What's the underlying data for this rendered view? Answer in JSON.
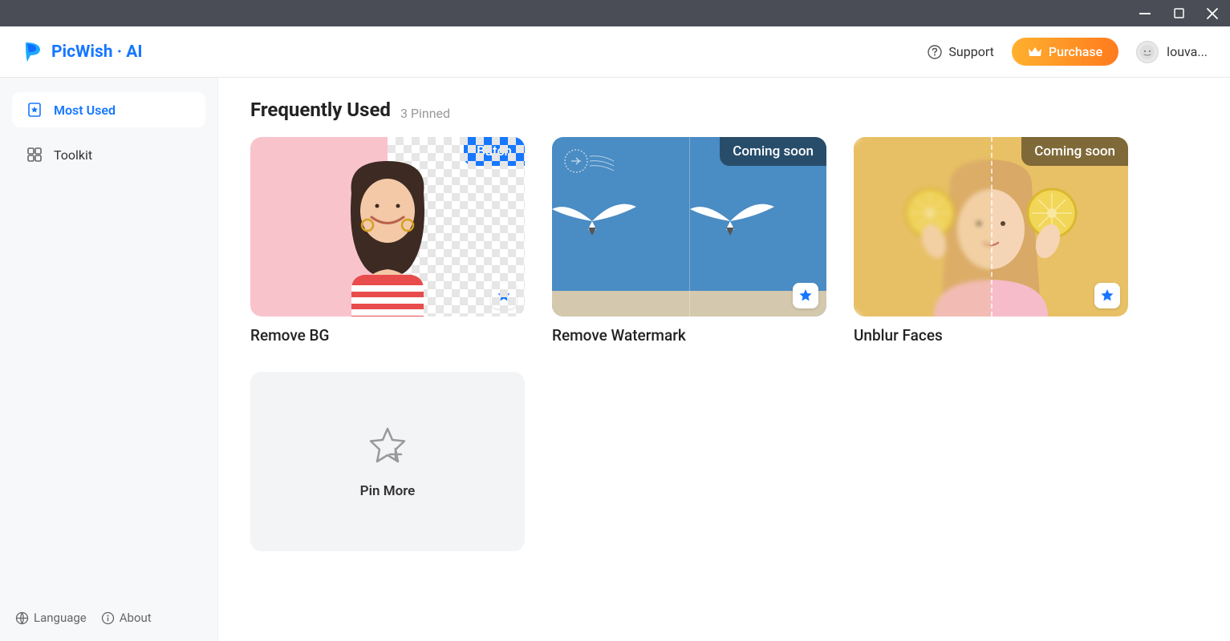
{
  "brand": {
    "name": "PicWish · AI"
  },
  "header": {
    "support_label": "Support",
    "purchase_label": "Purchase",
    "username": "louva..."
  },
  "sidebar": {
    "items": [
      {
        "label": "Most Used"
      },
      {
        "label": "Toolkit"
      }
    ],
    "footer": {
      "language_label": "Language",
      "about_label": "About"
    }
  },
  "section": {
    "title": "Frequently Used",
    "sub": "3 Pinned"
  },
  "cards": [
    {
      "title": "Remove BG",
      "badge": "Batch",
      "badge_style": "blue"
    },
    {
      "title": "Remove Watermark",
      "badge": "Coming soon",
      "badge_style": "dark"
    },
    {
      "title": "Unblur Faces",
      "badge": "Coming soon",
      "badge_style": "dark"
    }
  ],
  "pin_more": {
    "label": "Pin More"
  }
}
